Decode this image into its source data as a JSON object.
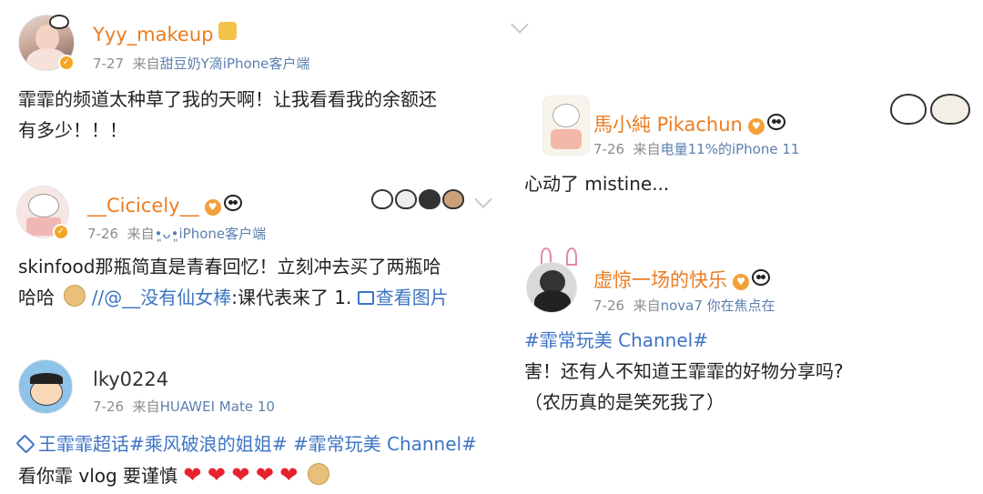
{
  "posts": [
    {
      "username": "Yyy_makeup",
      "date": "7-27",
      "from": "来自",
      "source": "甜豆奶Y滴iPhone客户端",
      "text_line1": "霏霏的频道太种草了我的天啊！让我看看我的余额还",
      "text_line2": "有多少！！！"
    },
    {
      "username": "__Cicicely__",
      "date": "7-26",
      "from": "来自",
      "source": "•͈ᴗ•͈iPhone客户端",
      "text_line1": "skinfood那瓶简直是青春回忆！立刻冲去买了两瓶哈",
      "text_line2_a": "哈哈",
      "text_line2_b": "//",
      "mention": "@__没有仙女棒",
      "text_line2_c": ":课代表来了 1.",
      "view_image": "查看图片"
    },
    {
      "username": "lky0224",
      "date": "7-26",
      "from": "来自",
      "source": "HUAWEI Mate 10",
      "tags": "王霏霏超话#乘风破浪的姐姐# #霏常玩美 Channel#",
      "text_line2": "看你霏 vlog 要谨慎"
    },
    {
      "username": "馬小純 Pikachun",
      "date": "7-26",
      "from": "来自",
      "source": "电量11%的iPhone 11",
      "text": "心动了 mistine..."
    },
    {
      "username": "虚惊一场的快乐",
      "date": "7-26",
      "from": "来自",
      "source": "nova7 你在焦点在",
      "tag": "#霏常玩美 Channel#",
      "text_line2": "害！还有人不知道王霏霏的好物分享吗?",
      "text_line3": "（农历真的是笑死我了）"
    }
  ],
  "icons": {
    "verified": "verified-badge-icon",
    "heart": "❤",
    "chevron": "chevron-down-icon"
  },
  "colors": {
    "username_vip": "#ea7d22",
    "link": "#3e74c4",
    "meta": "#8c8c8c",
    "heart": "#e8212f"
  }
}
